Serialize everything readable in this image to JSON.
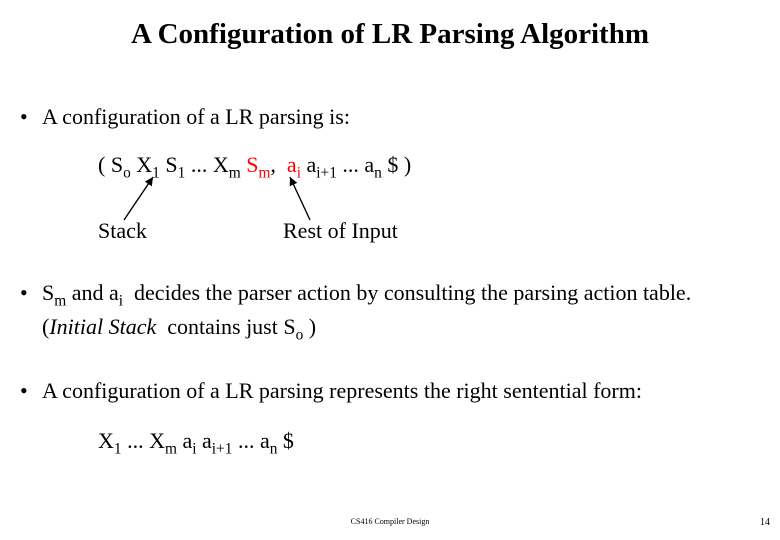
{
  "title": "A Configuration of LR Parsing Algorithm",
  "bullets": {
    "intro": "A configuration of a LR parsing is:",
    "action_html": "S<span class=\"sub\">m</span> and a<span class=\"sub\">i</span>&nbsp; decides the parser action by consulting the parsing action table.&nbsp; (<span class=\"italic\">Initial Stack</span>&nbsp; contains just S<span class=\"sub\">o</span> )",
    "sentential": "A configuration of a LR parsing represents the right sentential form:"
  },
  "config_html": "( S<span class=\"sub\">o</span> X<span class=\"sub\">1</span> S<span class=\"sub\">1</span> ... X<span class=\"sub\">m</span> <span class=\"red\">S<span class=\"sub\">m</span></span>,&nbsp; <span class=\"red\">a<span class=\"sub\">i</span></span> a<span class=\"sub\">i+1</span> ... a<span class=\"sub\">n</span> $ )",
  "labels": {
    "stack": "Stack",
    "rest": "Rest of Input"
  },
  "sentential_html": "X<span class=\"sub\">1</span> ... X<span class=\"sub\">m</span> a<span class=\"sub\">i</span> a<span class=\"sub\">i+1</span> ... a<span class=\"sub\">n</span> $",
  "footer": "CS416 Compiler Design",
  "page": "14"
}
